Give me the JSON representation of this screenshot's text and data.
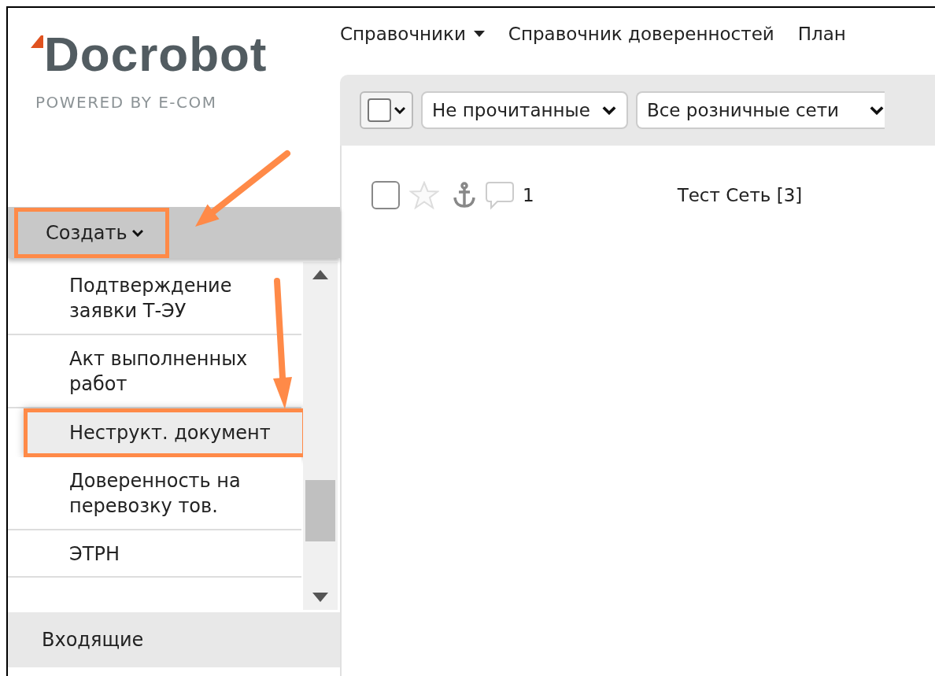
{
  "logo": {
    "name": "Docrobot",
    "tagline": "POWERED BY E-COM"
  },
  "sidebar": {
    "create_button": {
      "label": "Создать",
      "highlighted": true
    },
    "create_menu": [
      {
        "label": "Подтверждение заявки Т-ЭУ",
        "selected": false,
        "highlighted": false
      },
      {
        "label": "Акт выполненных работ",
        "selected": false,
        "highlighted": false
      },
      {
        "label": "Неструкт. документ",
        "selected": true,
        "highlighted": true
      },
      {
        "label": "Доверенность на перевозку тов.",
        "selected": false,
        "highlighted": false
      },
      {
        "label": "ЭТРН",
        "selected": false,
        "highlighted": false
      }
    ],
    "sections": [
      {
        "label": "Входящие"
      }
    ]
  },
  "top_nav": [
    {
      "label": "Справочники",
      "kind": "dropdown"
    },
    {
      "label": "Справочник доверенностей",
      "kind": "link"
    },
    {
      "label": "План",
      "kind": "link"
    }
  ],
  "toolbar": {
    "select_all": {
      "checked": false
    },
    "filters": [
      {
        "value": "Не прочитанные"
      },
      {
        "value": "Все розничные сети"
      }
    ]
  },
  "documents": [
    {
      "checked": false,
      "starred": false,
      "comments": "1",
      "network": "Тест Сеть [3]"
    }
  ],
  "callouts": [
    {
      "kind": "arrow"
    },
    {
      "kind": "arrow"
    }
  ]
}
